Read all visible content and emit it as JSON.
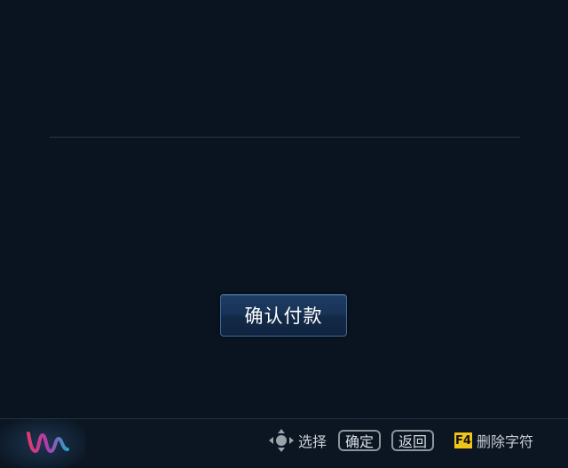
{
  "main": {
    "confirm_button_label": "确认付款"
  },
  "footer": {
    "hints": {
      "select_label": "选择",
      "confirm_key": "确定",
      "back_key": "返回",
      "f4_key": "F4",
      "f4_label": "删除字符"
    },
    "icons": {
      "logo": "brand-w-logo",
      "dpad": "dpad-icon"
    }
  }
}
